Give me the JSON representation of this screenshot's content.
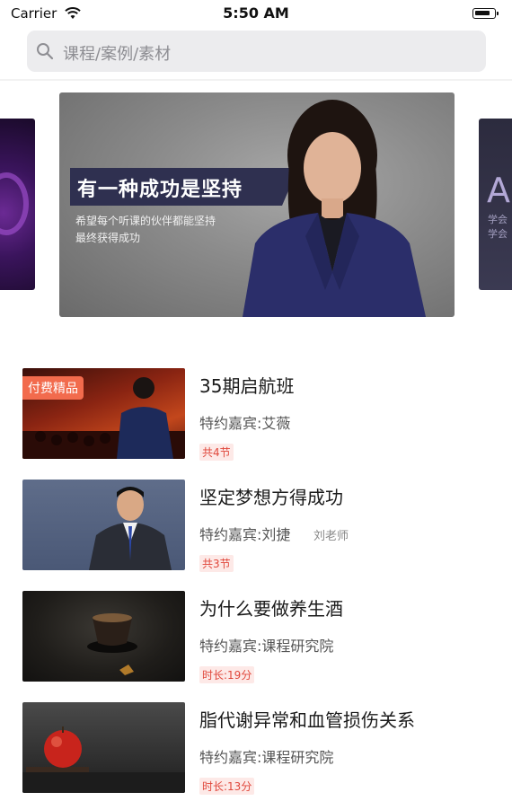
{
  "status_bar": {
    "carrier": "Carrier",
    "time": "5:50 AM"
  },
  "search": {
    "placeholder": "课程/案例/素材"
  },
  "banner": {
    "title": "有一种成功是坚持",
    "subtitle_line1": "希望每个听课的伙伴都能坚持",
    "subtitle_line2": "最终获得成功",
    "right_peek_letter": "A",
    "right_peek_line1": "学会",
    "right_peek_line2": "学会"
  },
  "courses": [
    {
      "title": "35期启航班",
      "guest": "特约嘉宾:艾薇",
      "teacher": "",
      "tag": "共4节",
      "badge": "付费精品"
    },
    {
      "title": "坚定梦想方得成功",
      "guest": "特约嘉宾:刘捷",
      "teacher": "刘老师",
      "tag": "共3节",
      "badge": ""
    },
    {
      "title": "为什么要做养生酒",
      "guest": "特约嘉宾:课程研究院",
      "teacher": "",
      "tag": "时长:19分",
      "badge": ""
    },
    {
      "title": "脂代谢异常和血管损伤关系",
      "guest": "特约嘉宾:课程研究院",
      "teacher": "",
      "tag": "时长:13分",
      "badge": ""
    }
  ],
  "colors": {
    "accent_red": "#e0473b",
    "badge_orange": "#f26b4d",
    "banner_box": "#2f3050"
  }
}
